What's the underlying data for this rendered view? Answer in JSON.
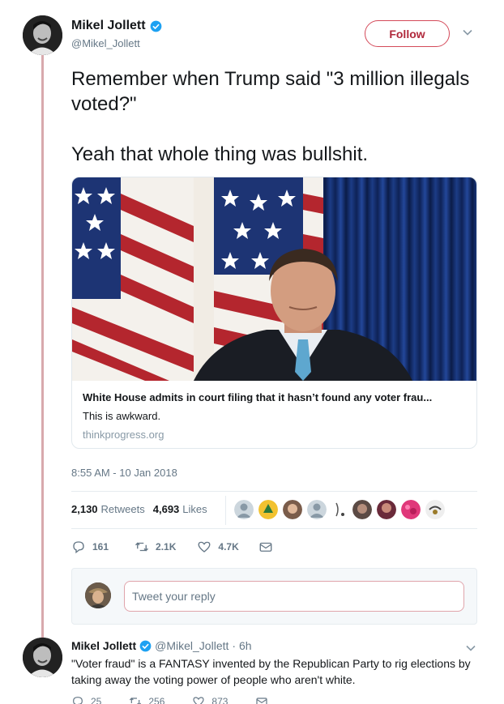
{
  "tweet": {
    "author": {
      "name": "Mikel Jollett",
      "handle": "@Mikel_Jollett",
      "verified": true
    },
    "follow_label": "Follow",
    "text": "Remember when Trump said \"3 million illegals voted?\"\n\nYeah that whole thing was bullshit.",
    "card": {
      "title": "White House admits in court filing that it hasn’t found any voter frau...",
      "description": "This is awkward.",
      "domain": "thinkprogress.org"
    },
    "timestamp": "8:55 AM - 10 Jan 2018",
    "stats": {
      "retweets_count": "2,130",
      "retweets_label": "Retweets",
      "likes_count": "4,693",
      "likes_label": "Likes"
    },
    "actions": {
      "replies": "161",
      "retweets": "2.1K",
      "likes": "4.7K"
    }
  },
  "reply_box": {
    "placeholder": "Tweet your reply"
  },
  "reply": {
    "name": "Mikel Jollett",
    "handle": "@Mikel_Jollett",
    "time": "· 6h",
    "text": "\"Voter fraud\" is a FANTASY invented by the Republican Party to rig elections by taking away the voting power of people who aren't white.",
    "actions": {
      "replies": "25",
      "retweets": "256",
      "likes": "873"
    }
  },
  "colors": {
    "accent": "#b0283b",
    "verified": "#1da1f2",
    "thread_line": "#d8a9ad",
    "muted": "#657786"
  }
}
